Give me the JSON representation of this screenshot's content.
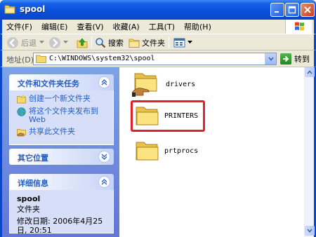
{
  "window": {
    "title": "spool",
    "title_icon": "folder-icon",
    "minimize_icon": "minimize-icon",
    "maximize_icon": "maximize-icon",
    "close_icon": "close-icon"
  },
  "menu": {
    "items": [
      "文件(F)",
      "编辑(E)",
      "查看(V)",
      "收藏(A)",
      "工具(T)",
      "帮助(H)"
    ]
  },
  "toolbar": {
    "back_label": "后退",
    "search_label": "搜索",
    "folders_label": "文件夹"
  },
  "address": {
    "label": "地址(D)",
    "value": "C:\\WINDOWS\\system32\\spool",
    "go_label": "转到"
  },
  "taskpane": {
    "tasks_title": "文件和文件夹任务",
    "tasks": [
      {
        "label": "创建一个新文件夹",
        "icon": "new-folder-icon"
      },
      {
        "label": "将这个文件夹发布到 Web",
        "icon": "globe-icon"
      },
      {
        "label": "共享此文件夹",
        "icon": "share-folder-icon"
      }
    ],
    "other_title": "其它位置",
    "details_title": "详细信息",
    "details_name": "spool",
    "details_type": "文件夹",
    "details_date": "修改日期: 2006年4月25日, 20:51"
  },
  "folders": [
    {
      "name": "drivers",
      "icon": "shared-folder-icon"
    },
    {
      "name": "PRINTERS",
      "icon": "folder-icon",
      "highlighted": true
    },
    {
      "name": "prtprocs",
      "icon": "folder-icon"
    }
  ],
  "colors": {
    "title_bar": "#0a46c8",
    "task_link": "#215dc6",
    "highlight": "#e0202a"
  }
}
